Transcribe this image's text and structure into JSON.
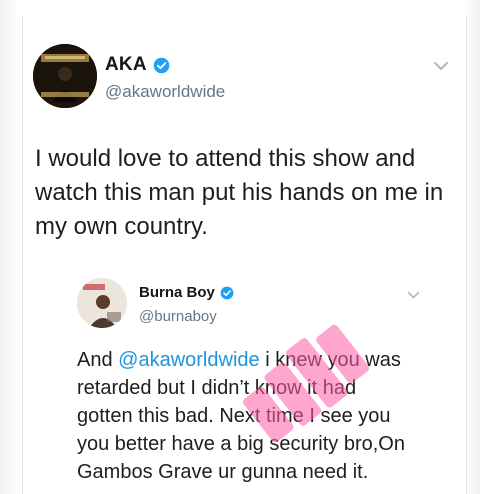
{
  "tweet": {
    "display_name": "AKA",
    "handle": "@akaworldwide",
    "text": "I would love to attend this show and watch this man put his hands on me in my own country."
  },
  "quoted_tweet": {
    "display_name": "Burna Boy",
    "handle": "@burnaboy",
    "text_before": "And ",
    "mention": "@akaworldwide",
    "text_after": " i knew you was retarded but I didn’t know it had gotten this bad. Next time I see you you better have a big security bro,On Gambos Grave ur gunna need it."
  },
  "icons": {
    "verified": "verified-badge-icon",
    "caret": "chevron-down-icon"
  },
  "colors": {
    "verified_blue": "#1da1f2",
    "mention_blue": "#1b95e0",
    "handle_gray": "#657786",
    "watermark_pink": "#ff5fa8"
  }
}
